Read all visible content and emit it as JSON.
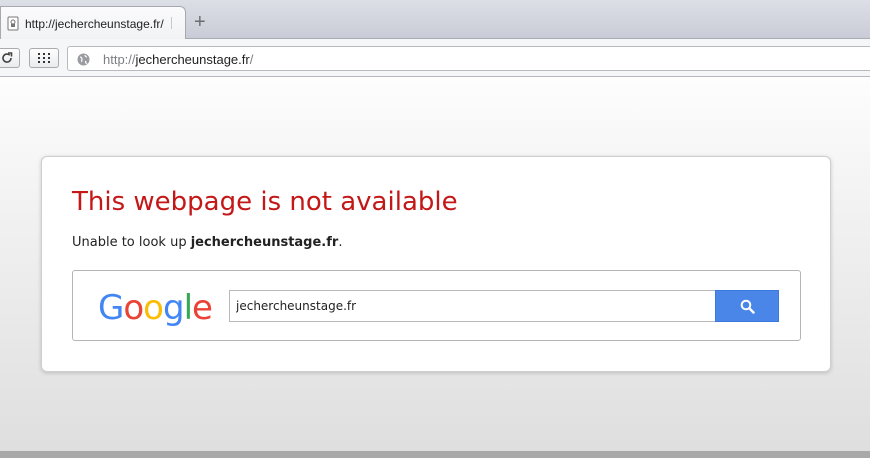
{
  "browser": {
    "tab": {
      "title": "http://jechercheunstage.fr/",
      "favicon": "lock-doc-icon"
    },
    "new_tab_icon": "plus-icon",
    "toolbar": {
      "reload_icon": "reload-icon",
      "apps_icon": "apps-grid-icon",
      "omnibox": {
        "scheme": "http://",
        "host": "jechercheunstage.fr",
        "path": "/",
        "globe_icon": "globe-icon"
      }
    }
  },
  "error_page": {
    "title": "This webpage is not available",
    "desc_prefix": "Unable to look up ",
    "desc_host": "jechercheunstage.fr",
    "desc_suffix": ".",
    "search": {
      "logo": {
        "G": "G",
        "o1": "o",
        "o2": "o",
        "g": "g",
        "l": "l",
        "e": "e"
      },
      "value": "jechercheunstage.fr",
      "button_icon": "search-icon"
    },
    "colors": {
      "title": "#c41717",
      "button": "#4a86e8"
    }
  }
}
